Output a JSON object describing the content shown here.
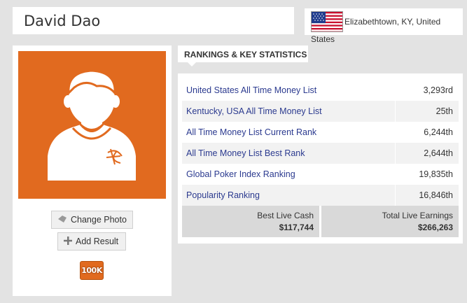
{
  "player": {
    "name": "David Dao"
  },
  "location": {
    "flag_icon": "us-flag-icon",
    "line1": "Elizabethtown, KY, United",
    "line2": "States"
  },
  "profile": {
    "avatar_icon": "default-avatar-icon",
    "change_photo_label": "Change Photo",
    "add_result_label": "Add Result",
    "badge_label": "100K"
  },
  "rankings": {
    "title": "RANKINGS & KEY STATISTICS",
    "rows": [
      {
        "label": "United States All Time Money List",
        "value": "3,293rd"
      },
      {
        "label": "Kentucky, USA All Time Money List",
        "value": "25th"
      },
      {
        "label": "All Time Money List Current Rank",
        "value": "6,244th"
      },
      {
        "label": "All Time Money List Best Rank",
        "value": "2,644th"
      },
      {
        "label": "Global Poker Index Ranking",
        "value": "19,835th"
      },
      {
        "label": "Popularity Ranking",
        "value": "16,846th"
      }
    ],
    "best_live_cash_label": "Best Live Cash",
    "best_live_cash_value": "$117,744",
    "total_live_earnings_label": "Total Live Earnings",
    "total_live_earnings_value": "$266,263"
  },
  "colors": {
    "accent": "#e16a1f",
    "link": "#2b3a8f"
  }
}
